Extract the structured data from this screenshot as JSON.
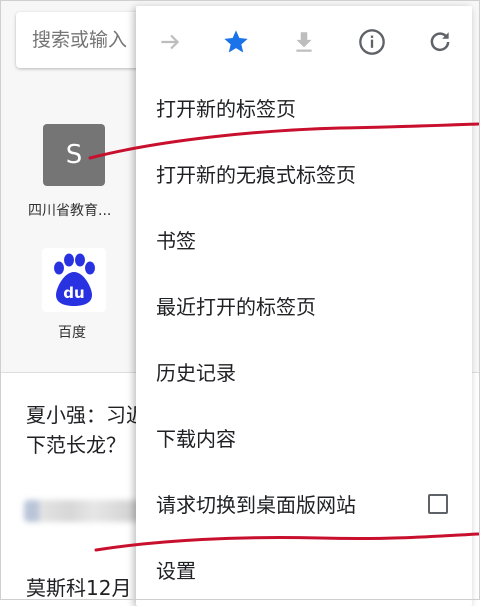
{
  "background": {
    "search_placeholder": "搜索或输入",
    "tiles": [
      {
        "letter": "S",
        "label": "四川省教育..."
      },
      {
        "label": "百度",
        "icon": "baidu-du-icon"
      }
    ],
    "articles": [
      {
        "title_line1": "夏小强：习近",
        "title_line2": "下范长龙？"
      },
      {
        "title": "莫斯科12月"
      }
    ]
  },
  "menu": {
    "toolbar": [
      {
        "icon": "forward-arrow-icon",
        "enabled": false
      },
      {
        "icon": "star-icon",
        "active": true,
        "color": "#1a73e8"
      },
      {
        "icon": "download-icon",
        "enabled": false
      },
      {
        "icon": "info-icon"
      },
      {
        "icon": "refresh-icon"
      }
    ],
    "items": [
      {
        "label": "打开新的标签页"
      },
      {
        "label": "打开新的无痕式标签页"
      },
      {
        "label": "书签"
      },
      {
        "label": "最近打开的标签页"
      },
      {
        "label": "历史记录"
      },
      {
        "label": "下载内容"
      },
      {
        "label": "请求切换到桌面版网站",
        "checkbox": false
      },
      {
        "label": "设置"
      }
    ]
  },
  "colors": {
    "accent_blue": "#1a73e8",
    "annotation_red": "#c8102e",
    "baidu_blue": "#2932e1"
  }
}
